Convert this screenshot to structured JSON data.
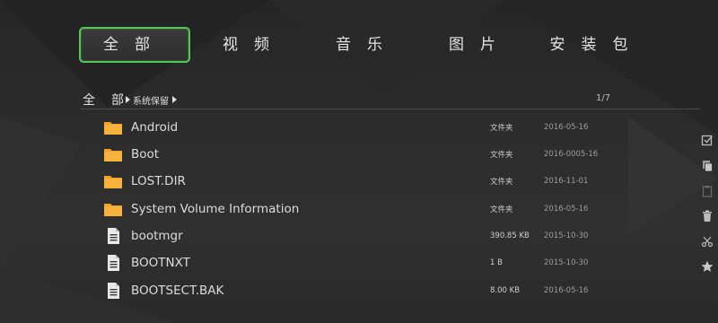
{
  "tabs": [
    {
      "label": "全部",
      "active": true
    },
    {
      "label": "视频",
      "active": false
    },
    {
      "label": "音乐",
      "active": false
    },
    {
      "label": "图片",
      "active": false
    },
    {
      "label": "安装包",
      "active": false
    }
  ],
  "breadcrumb": {
    "root": "全部",
    "sub": "系统保留"
  },
  "page_counter": "1/7",
  "files": [
    {
      "name": "Android",
      "type": "folder",
      "size": "文件夹",
      "date": "2016-05-16"
    },
    {
      "name": "Boot",
      "type": "folder",
      "size": "文件夹",
      "date": "2016-0005-16"
    },
    {
      "name": "LOST.DIR",
      "type": "folder",
      "size": "文件夹",
      "date": "2016-11-01"
    },
    {
      "name": "System Volume Information",
      "type": "folder",
      "size": "文件夹",
      "date": "2016-05-16"
    },
    {
      "name": "bootmgr",
      "type": "file",
      "size": "390.85 KB",
      "date": "2015-10-30"
    },
    {
      "name": "BOOTNXT",
      "type": "file",
      "size": "1 B",
      "date": "2015-10-30"
    },
    {
      "name": "BOOTSECT.BAK",
      "type": "file",
      "size": "8.00 KB",
      "date": "2016-05-16"
    }
  ],
  "toolbar": [
    "select-all-icon",
    "copy-icon",
    "paste-icon",
    "delete-icon",
    "cut-icon",
    "favorite-icon"
  ],
  "colors": {
    "accent": "#55c755",
    "folder": "#f2a22a",
    "background": "#2a2a2a"
  }
}
